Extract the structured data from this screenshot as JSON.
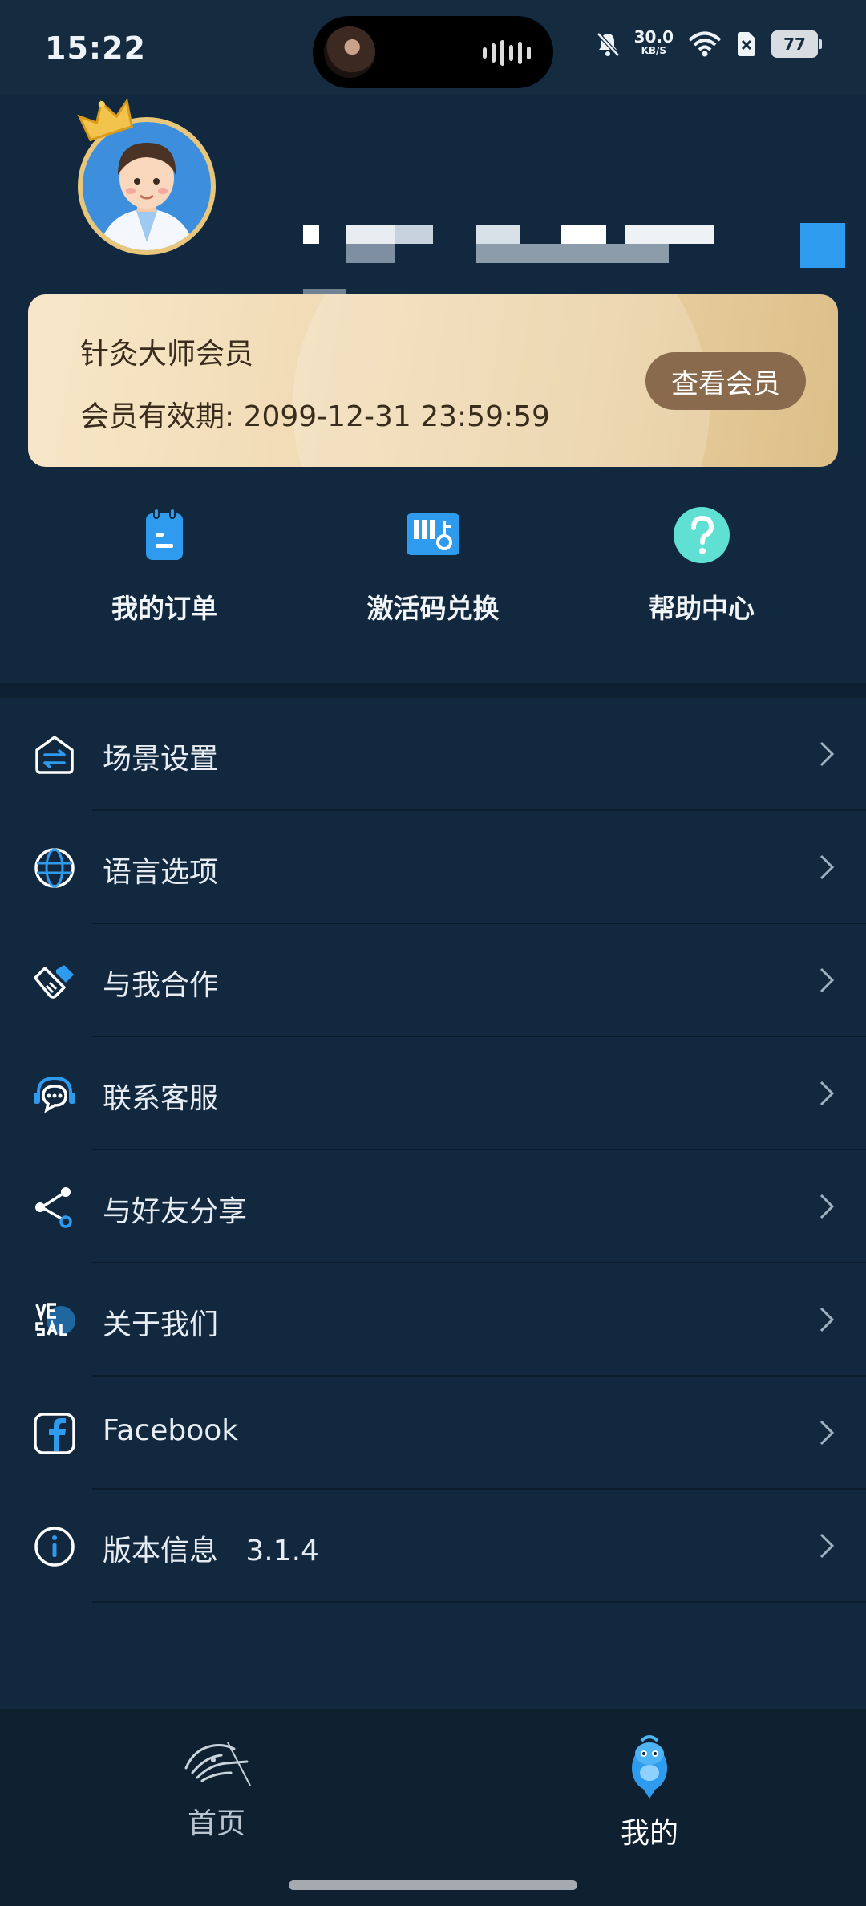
{
  "status_bar": {
    "time": "15:22",
    "net_speed_value": "30.0",
    "net_speed_unit": "KB/S",
    "battery_level": "77",
    "icons": [
      "bell-muted-icon",
      "wifi-icon",
      "sim-off-icon",
      "battery-icon"
    ]
  },
  "profile": {
    "avatar_icon": "doctor-avatar",
    "badge_icon": "crown-icon"
  },
  "vip_card": {
    "title": "针灸大师会员",
    "expiry": "会员有效期: 2099-12-31 23:59:59",
    "button_label": "查看会员"
  },
  "quick_actions": [
    {
      "label": "我的订单",
      "icon": "order-clipboard-icon"
    },
    {
      "label": "激活码兑换",
      "icon": "activation-code-icon"
    },
    {
      "label": "帮助中心",
      "icon": "help-question-icon"
    }
  ],
  "menu": [
    {
      "label": "场景设置",
      "icon": "scene-house-icon"
    },
    {
      "label": "语言选项",
      "icon": "globe-icon"
    },
    {
      "label": "与我合作",
      "icon": "handshake-icon"
    },
    {
      "label": "联系客服",
      "icon": "headset-chat-icon"
    },
    {
      "label": "与好友分享",
      "icon": "share-icon"
    },
    {
      "label": "关于我们",
      "icon": "vesal-logo-icon"
    },
    {
      "label": "Facebook",
      "icon": "facebook-icon"
    },
    {
      "label": "版本信息   3.1.4",
      "icon": "info-icon"
    }
  ],
  "tab_bar": {
    "tabs": [
      {
        "label": "首页",
        "icon": "acupuncture-hand-icon",
        "active": false
      },
      {
        "label": "我的",
        "icon": "mascot-icon",
        "active": true
      }
    ]
  },
  "colors": {
    "background": "#11283e",
    "vip_card": "#f0dab3",
    "vip_button": "#8a6a4d",
    "accent_blue": "#2f9bef",
    "help_teal": "#5fe0d2"
  }
}
